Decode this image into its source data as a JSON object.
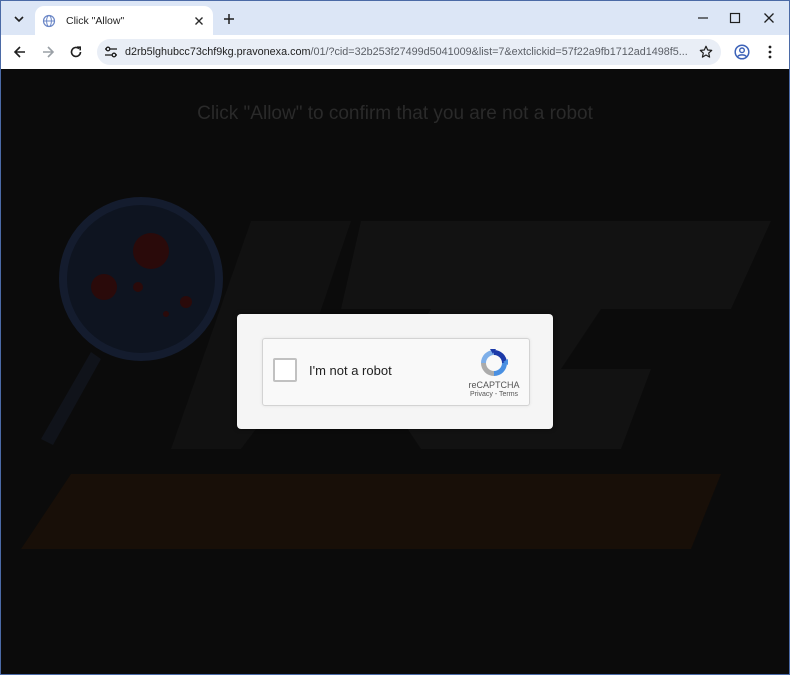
{
  "browser": {
    "tab": {
      "title": "Click \"Allow\""
    },
    "address_bar": {
      "host": "d2rb5lghubcc73chf9kg.pravonexa.com",
      "path": "/01/?cid=32b253f27499d5041009&list=7&extclickid=57f22a9fb1712ad1498f5..."
    }
  },
  "page": {
    "headline": "Click \"Allow\" to confirm that you are not a robot",
    "captcha": {
      "checkbox_label": "I'm not a robot",
      "brand": "reCAPTCHA",
      "privacy_link": "Privacy",
      "separator": " - ",
      "terms_link": "Terms"
    }
  },
  "icons": [
    "tab-search-icon",
    "globe-favicon-icon",
    "close-icon",
    "plus-icon",
    "minimize-icon",
    "maximize-icon",
    "window-close-icon",
    "back-arrow-icon",
    "forward-arrow-icon",
    "reload-icon",
    "site-settings-icon",
    "star-icon",
    "profile-icon",
    "kebab-menu-icon",
    "recaptcha-logo-icon"
  ],
  "colors": {
    "tab_strip": "#dce6f6",
    "omnibox": "#e9eef6",
    "page_bg": "#0b0b0b",
    "dialog": "#f5f5f5"
  }
}
